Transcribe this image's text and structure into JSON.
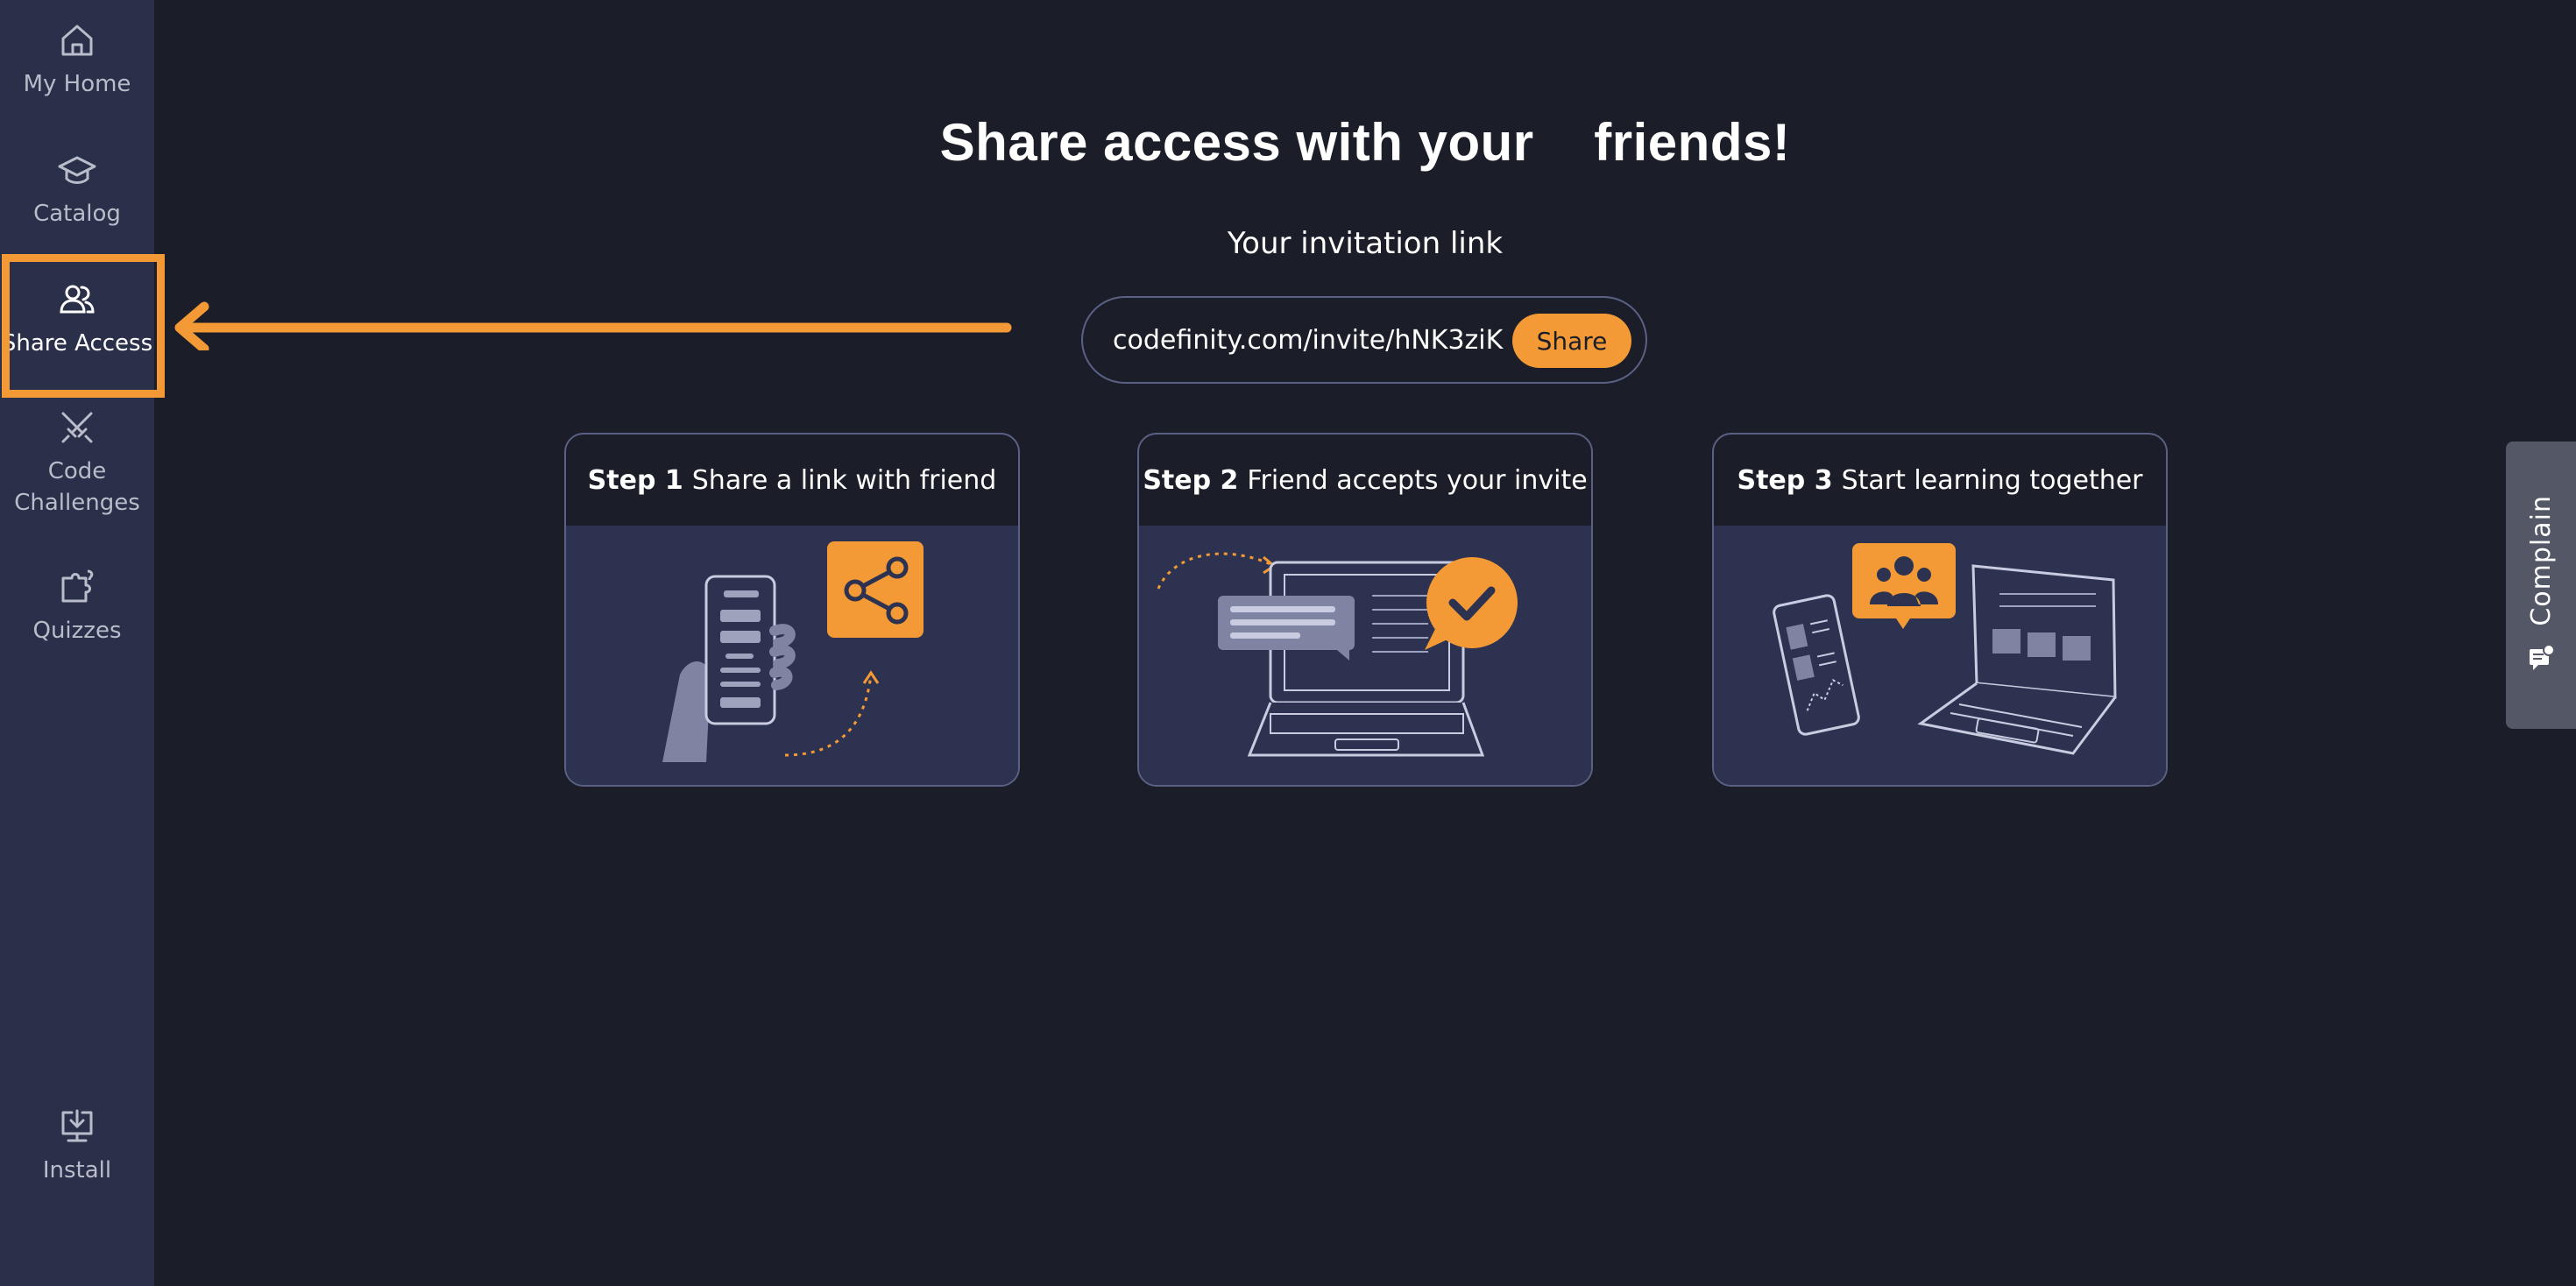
{
  "sidebar": {
    "items": [
      {
        "label": "My Home",
        "icon": "home-icon"
      },
      {
        "label": "Catalog",
        "icon": "graduation-cap-icon"
      },
      {
        "label": "Share Access",
        "icon": "users-icon",
        "active": true
      },
      {
        "label": "Code\nChallenges",
        "icon": "crossed-swords-icon"
      },
      {
        "label": "Quizzes",
        "icon": "puzzle-icon"
      }
    ],
    "install": {
      "label": "Install",
      "icon": "install-icon"
    }
  },
  "main": {
    "title": "Share access with your    friends!",
    "subtitle": "Your invitation link",
    "invite_link": "codefinity.com/invite/hNK3ziK",
    "share_label": "Share",
    "steps": [
      {
        "step": "Step 1",
        "text": "Share a link with friend"
      },
      {
        "step": "Step 2",
        "text": "Friend accepts your invite"
      },
      {
        "step": "Step 3",
        "text": "Start learning together"
      }
    ]
  },
  "complain": {
    "label": "Complain",
    "icon": "feedback-icon"
  },
  "colors": {
    "background": "#1b1e28",
    "sidebar": "#2a2f4a",
    "accent": "#f39a36",
    "card_illustration": "#2c3250",
    "border": "#5a6185"
  }
}
